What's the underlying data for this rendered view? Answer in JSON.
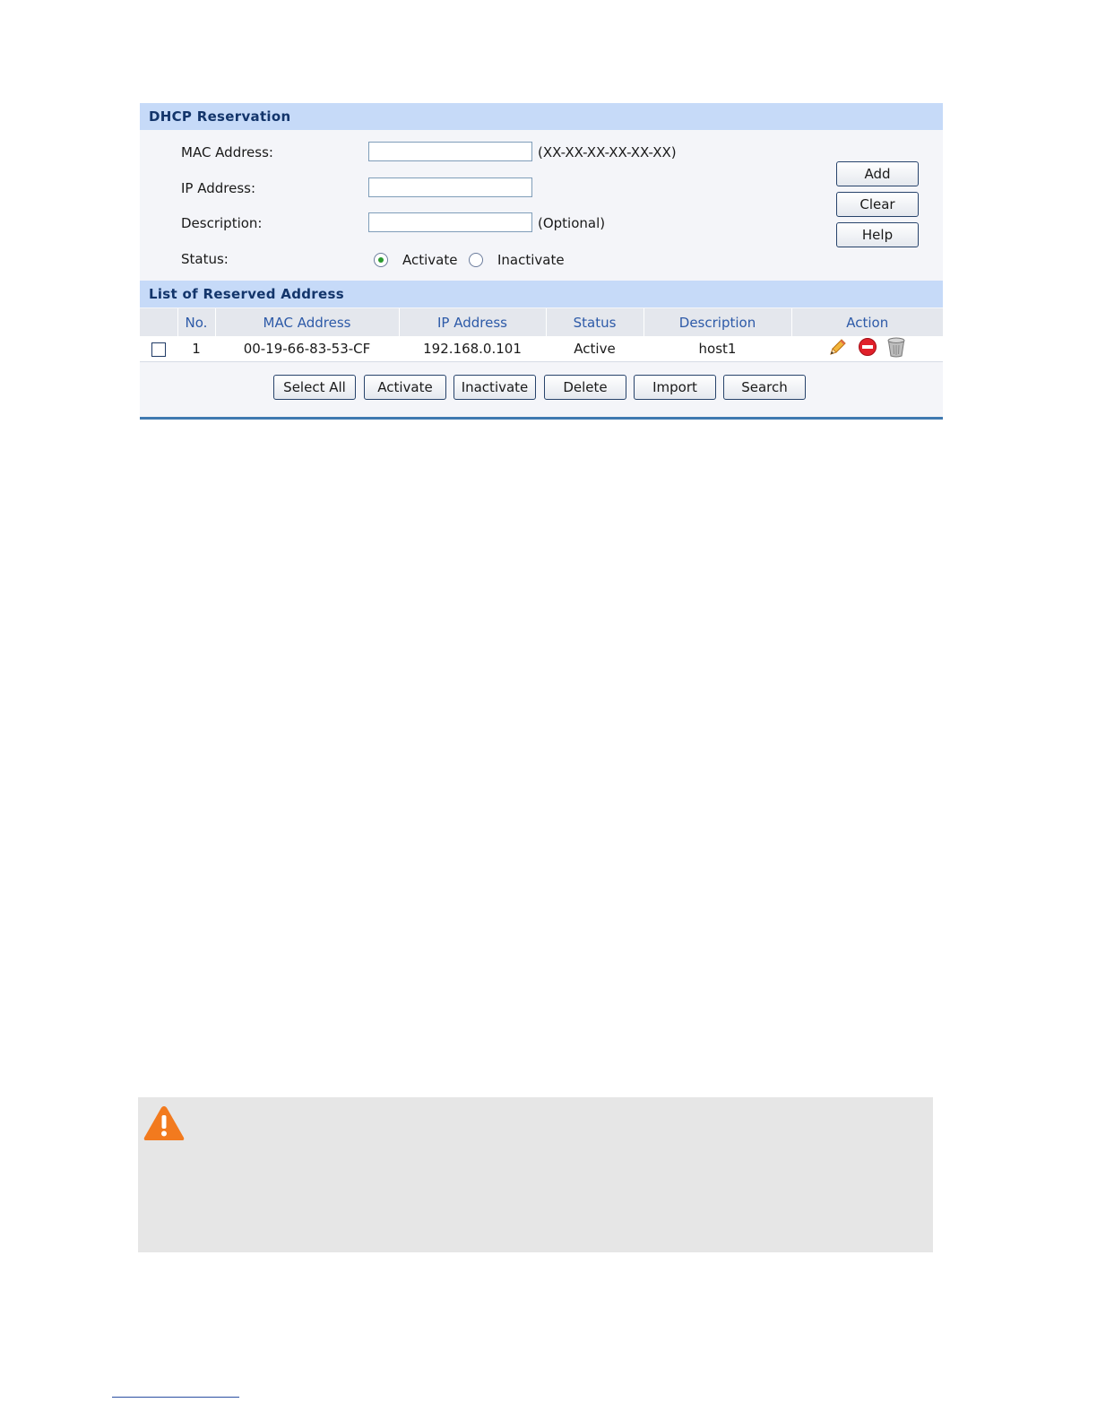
{
  "dhcp_reservation": {
    "title": "DHCP Reservation",
    "mac_label": "MAC Address:",
    "mac_value": "",
    "mac_hint": "(XX-XX-XX-XX-XX-XX)",
    "ip_label": "IP Address:",
    "ip_value": "",
    "description_label": "Description:",
    "description_value": "",
    "description_hint": "(Optional)",
    "status_label": "Status:",
    "status_options": [
      "Activate",
      "Inactivate"
    ],
    "status_selected": "Activate",
    "buttons": {
      "add": "Add",
      "clear": "Clear",
      "help": "Help"
    }
  },
  "reserved_list": {
    "title": "List of Reserved Address",
    "columns": [
      "No.",
      "MAC Address",
      "IP Address",
      "Status",
      "Description",
      "Action"
    ],
    "rows": [
      {
        "no": "1",
        "mac": "00-19-66-83-53-CF",
        "ip": "192.168.0.101",
        "status": "Active",
        "description": "host1",
        "actions": [
          "edit-pencil-icon",
          "deactivate-icon",
          "delete-trash-icon"
        ]
      }
    ],
    "buttons": {
      "select_all": "Select All",
      "activate": "Activate",
      "inactivate": "Inactivate",
      "delete": "Delete",
      "import": "Import",
      "search": "Search"
    }
  },
  "note_box": {
    "icon": "warning-icon"
  },
  "colors": {
    "section_header": "#c6daf8",
    "header_text": "#13356b",
    "table_header_text": "#2d5aa8",
    "panel_border": "#3f79b0",
    "warning_orange": "#f27a1e"
  }
}
